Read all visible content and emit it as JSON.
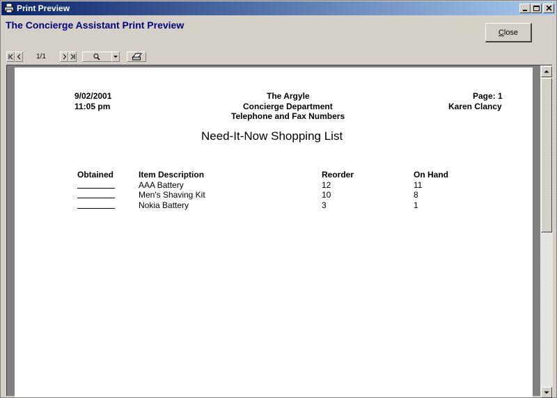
{
  "window": {
    "title": "Print Preview"
  },
  "header": {
    "app_title": "The Concierge Assistant Print Preview",
    "close_label_mnemonic": "C",
    "close_label_rest": "lose"
  },
  "toolbar": {
    "page_indicator": "1/1",
    "icons": [
      "first-page-icon",
      "prev-page-icon",
      "next-page-icon",
      "last-page-icon",
      "zoom-icon",
      "dropdown-icon",
      "print-icon"
    ]
  },
  "report": {
    "date": "9/02/2001",
    "time": "11:05 pm",
    "hotel": "The Argyle",
    "department": "Concierge Department",
    "subtitle": "Telephone and Fax Numbers",
    "page_label": "Page: 1",
    "user": "Karen Clancy",
    "title": "Need-It-Now Shopping List",
    "columns": [
      "Obtained",
      "Item Description",
      "Reorder",
      "On Hand"
    ],
    "rows": [
      {
        "item": "AAA Battery",
        "reorder": "12",
        "on_hand": "11"
      },
      {
        "item": "Men's Shaving Kit",
        "reorder": "10",
        "on_hand": "8"
      },
      {
        "item": "Nokia Battery",
        "reorder": "3",
        "on_hand": "1"
      }
    ]
  },
  "colors": {
    "titlebar_start": "#0a246a",
    "titlebar_end": "#a6caf0",
    "heading": "#000080",
    "chrome": "#d4d0c8"
  }
}
